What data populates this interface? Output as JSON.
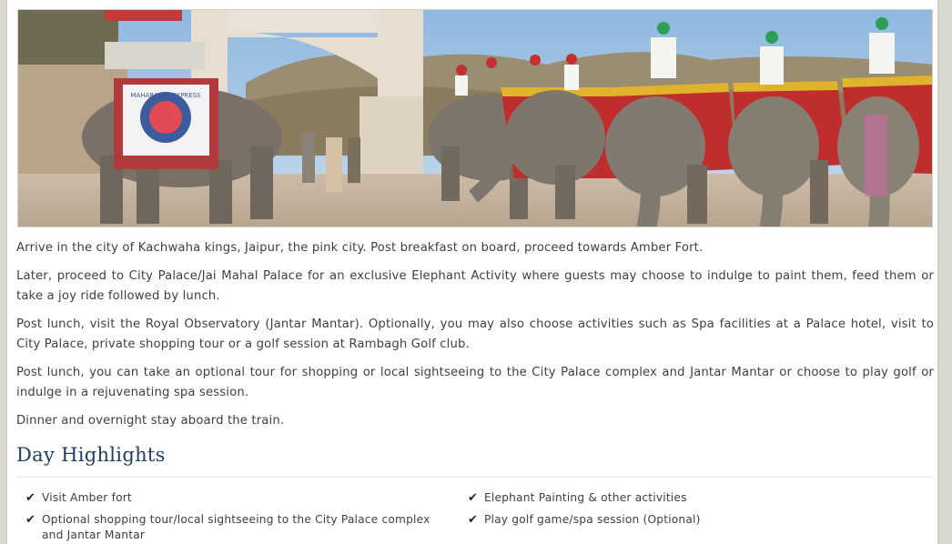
{
  "hero": {
    "banner_text": "MAHARAJAS' EXPRESS"
  },
  "content": {
    "paragraphs": [
      "Arrive in the city of Kachwaha kings, Jaipur, the pink city. Post breakfast on board, proceed towards Amber Fort.",
      "Later, proceed to City Palace/Jai Mahal Palace for an exclusive Elephant Activity where guests may choose to indulge to paint them, feed them or take a joy ride followed by lunch.",
      "Post lunch, visit the Royal Observatory (Jantar Mantar). Optionally, you may also choose activities such as Spa facilities at a Palace hotel, visit to City Palace, private shopping tour or a golf session at Rambagh Golf club.",
      "Post lunch, you can take an optional tour for shopping or local sightseeing to the City Palace complex and Jantar Mantar or choose to play golf or indulge in a rejuvenating spa session.",
      "Dinner and overnight stay aboard the train."
    ]
  },
  "highlights": {
    "title": "Day Highlights",
    "check_icon": "check-icon",
    "items": [
      "Visit Amber fort",
      "Elephant Painting & other activities",
      "Optional shopping tour/local sightseeing to the City Palace complex and Jantar Mantar",
      "Play golf game/spa session (Optional)"
    ]
  }
}
